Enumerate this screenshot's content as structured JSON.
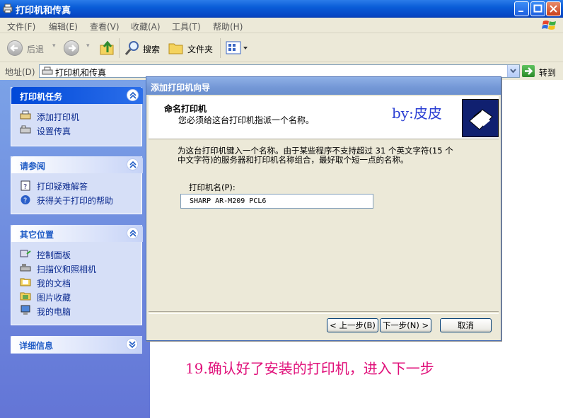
{
  "window": {
    "title": "打印机和传真"
  },
  "menu": [
    "文件(F)",
    "编辑(E)",
    "查看(V)",
    "收藏(A)",
    "工具(T)",
    "帮助(H)"
  ],
  "toolbar": {
    "back_label": "后退",
    "search_label": "搜索",
    "folders_label": "文件夹"
  },
  "address": {
    "label": "地址(D)",
    "value": "打印机和传真",
    "go_label": "转到"
  },
  "panels": [
    {
      "title": "打印机任务",
      "items": [
        {
          "label": "添加打印机",
          "icon": "add-printer-icon"
        },
        {
          "label": "设置传真",
          "icon": "fax-icon"
        }
      ]
    },
    {
      "title": "请参阅",
      "items": [
        {
          "label": "打印疑难解答",
          "icon": "help-book-icon"
        },
        {
          "label": "获得关于打印的帮助",
          "icon": "help-circle-icon"
        }
      ]
    },
    {
      "title": "其它位置",
      "items": [
        {
          "label": "控制面板",
          "icon": "control-panel-icon"
        },
        {
          "label": "扫描仪和照相机",
          "icon": "scanner-icon"
        },
        {
          "label": "我的文档",
          "icon": "documents-icon"
        },
        {
          "label": "图片收藏",
          "icon": "pictures-icon"
        },
        {
          "label": "我的电脑",
          "icon": "computer-icon"
        }
      ]
    },
    {
      "title": "详细信息",
      "items": []
    }
  ],
  "wizard": {
    "title": "添加打印机向导",
    "heading": "命名打印机",
    "subheading": "您必须给这台打印机指派一个名称。",
    "watermark": "by:皮皮",
    "description_line1": "为这台打印机键入一个名称。由于某些程序不支持超过 31 个英文字符(15 个",
    "description_line2": "中文字符)的服务器和打印机名称组合，最好取个短一点的名称。",
    "name_label": "打印机名(P):",
    "name_value": "SHARP AR-M209 PCL6",
    "back_button": "< 上一步(B)",
    "next_button": "下一步(N) >",
    "cancel_button": "取消"
  },
  "annotation": "19.确认好了安装的打印机，进入下一步",
  "colors": {
    "titlebar": "#0A5DD8",
    "annotation": "#E0107A",
    "watermark": "#2B3FD3"
  }
}
